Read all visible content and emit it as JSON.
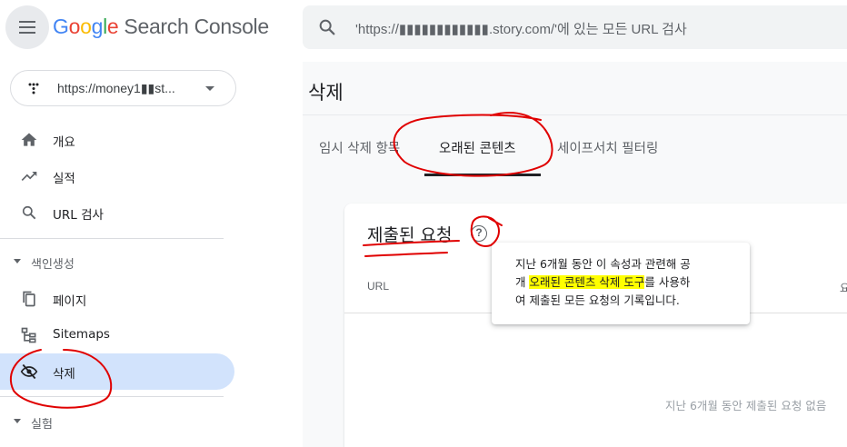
{
  "header": {
    "logo": {
      "g1": "G",
      "o1": "o",
      "o2": "o",
      "g2": "g",
      "l": "l",
      "e": "e",
      "product": "Search Console"
    },
    "search_placeholder": "'https://▮▮▮▮▮▮▮▮▮▮▮▮.story.com/'에 있는 모든 URL 검사"
  },
  "sidebar": {
    "property": "https://money1▮▮st...",
    "items": [
      {
        "label": "개요",
        "icon": "home-icon"
      },
      {
        "label": "실적",
        "icon": "trending-up-icon"
      },
      {
        "label": "URL 검사",
        "icon": "search-icon"
      }
    ],
    "index_section": "색인생성",
    "index_items": [
      {
        "label": "페이지",
        "icon": "pages-icon"
      },
      {
        "label": "Sitemaps",
        "icon": "sitemap-icon"
      },
      {
        "label": "삭제",
        "icon": "eye-off-icon",
        "active": true
      }
    ],
    "experiment_section": "실험"
  },
  "main": {
    "page_title": "삭제",
    "tabs": [
      {
        "label": "임시 삭제 항목"
      },
      {
        "label": "오래된 콘텐츠",
        "active": true
      },
      {
        "label": "세이프서치 필터링"
      }
    ],
    "card": {
      "title": "제출된 요청",
      "col_url": "URL",
      "col_right": "요",
      "empty": "지난 6개월 동안 제출된 요청 없음"
    },
    "tooltip": {
      "line1": "지난 6개월 동안 이 속성과 관련해 공",
      "line2_pre": "개 ",
      "line2_hl": "오래된 콘텐츠 삭제 도구",
      "line2_post": "를 사용하",
      "line3": "여 제출된 모든 요청의 기록입니다."
    }
  },
  "colors": {
    "accent": "#1a73e8",
    "active_nav": "#d2e3fc",
    "annotation": "#e00000",
    "highlight": "#ffff00"
  }
}
